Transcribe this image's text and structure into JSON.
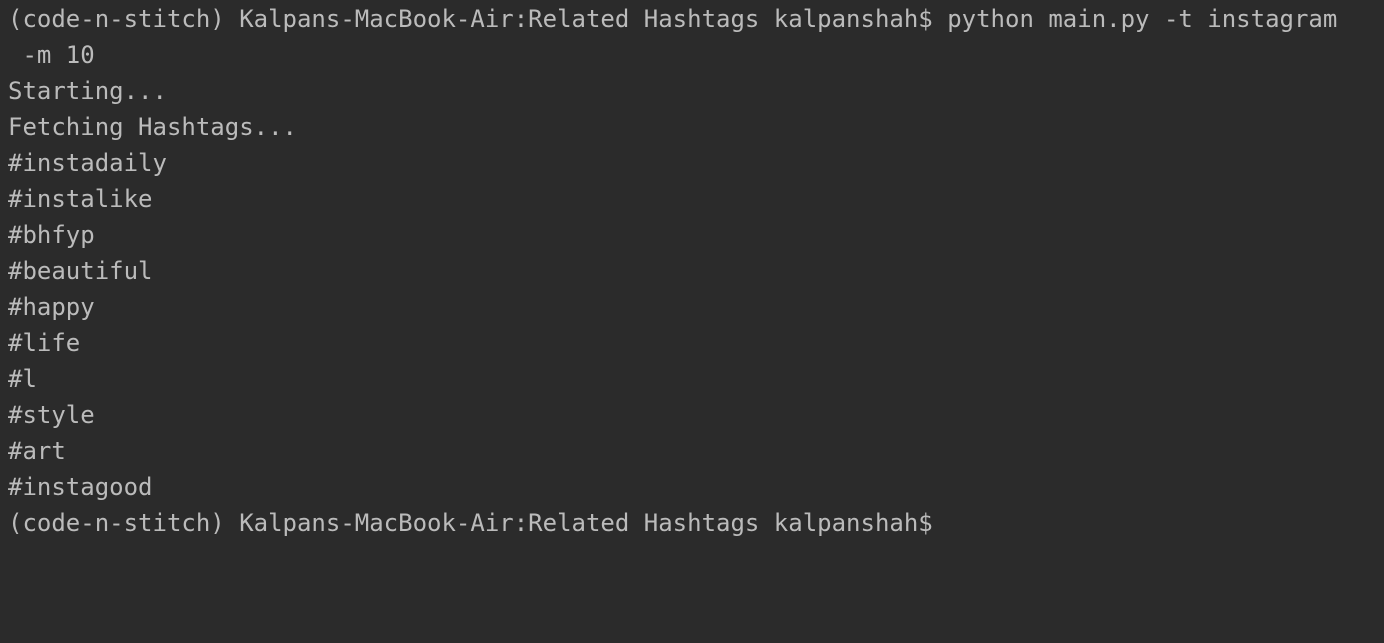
{
  "terminal": {
    "prompt": "(code-n-stitch) Kalpans-MacBook-Air:Related Hashtags kalpanshah$",
    "command_line_1": " python main.py -t instagram",
    "command_line_2": " -m 10",
    "output": [
      "Starting...",
      "Fetching Hashtags...",
      "#instadaily",
      "#instalike",
      "#bhfyp",
      "#beautiful",
      "#happy",
      "#life",
      "#l",
      "#style",
      "#art",
      "#instagood"
    ],
    "final_prompt": "(code-n-stitch) Kalpans-MacBook-Air:Related Hashtags kalpanshah$"
  }
}
